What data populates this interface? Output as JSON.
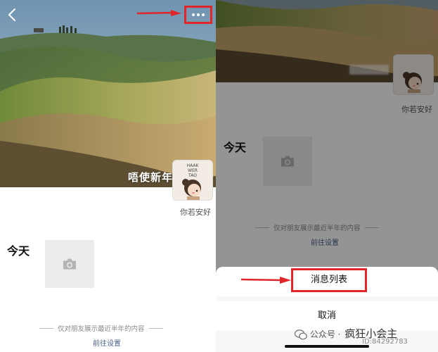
{
  "left": {
    "nickname": "唔使新年",
    "avatar_text": [
      "HAAK",
      "WER",
      "TAO"
    ],
    "signature": "你若安好",
    "day_label": "今天",
    "notice": "仅对朋友展示最近半年的内容",
    "settings_link": "前往设置"
  },
  "right": {
    "signature": "你若安好",
    "day_label": "今天",
    "notice": "仅对朋友展示最近半年的内容",
    "settings_link": "前往设置",
    "sheet": {
      "message_list": "消息列表",
      "cancel": "取消"
    },
    "watermark": {
      "prefix": "公众号 ·",
      "name": "疯狂小会主",
      "id": "ID:84292783"
    }
  },
  "colors": {
    "highlight": "#e1262a",
    "link": "#4b6189"
  },
  "icons": {
    "back": "chevron-left-icon",
    "more": "more-dots-icon",
    "camera": "camera-icon",
    "wechat": "wechat-icon"
  }
}
